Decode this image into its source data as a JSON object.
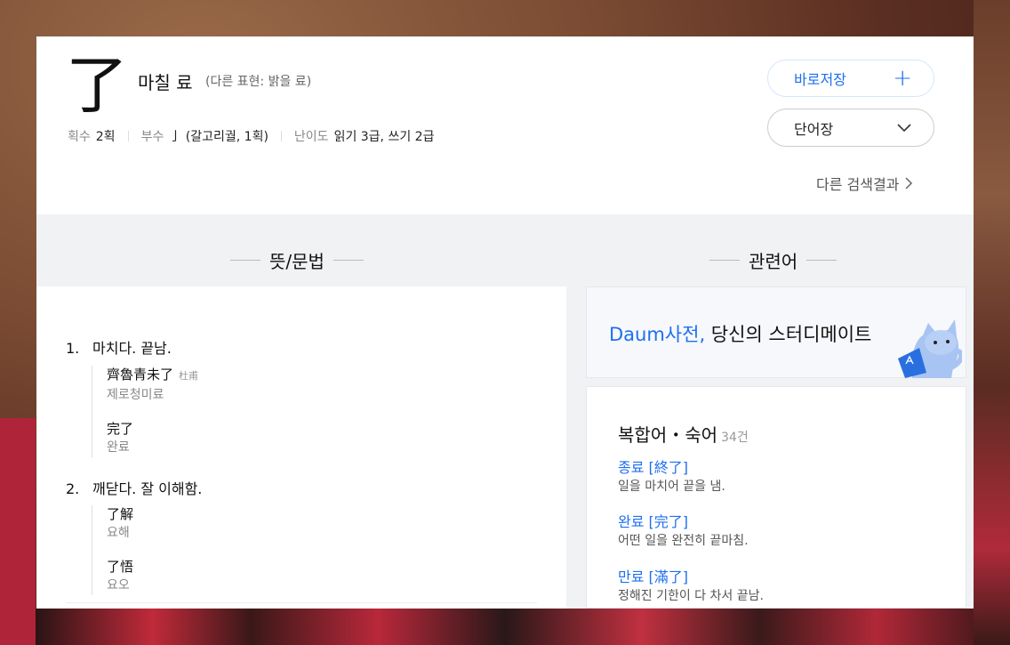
{
  "header": {
    "hanja": "了",
    "reading": "마칠 료",
    "alt_reading": "(다른 표현: 밝을 료)",
    "stroke_label": "획수",
    "stroke_value": "2획",
    "radical_label": "부수",
    "radical_value": "亅 (갈고리궐, 1획)",
    "level_label": "난이도",
    "level_value": "읽기 3급, 쓰기 2급",
    "save_label": "바로저장",
    "wordbook_label": "단어장",
    "other_results": "다른 검색결과"
  },
  "sections": {
    "meaning_title": "뜻/문법",
    "related_title": "관련어"
  },
  "definitions": [
    {
      "num": "1.",
      "text": "마치다. 끝남.",
      "examples": [
        {
          "han": "齊魯青未了",
          "src": "杜甫",
          "kor": "제로청미료"
        },
        {
          "han": "完了",
          "src": "",
          "kor": "완료"
        }
      ]
    },
    {
      "num": "2.",
      "text": "깨닫다. 잘 이해함.",
      "examples": [
        {
          "han": "了解",
          "src": "",
          "kor": "요해"
        },
        {
          "han": "了悟",
          "src": "",
          "kor": "요오"
        }
      ]
    }
  ],
  "banner": {
    "brand": "Daum사전,",
    "text": " 당신의 스터디메이트"
  },
  "related": {
    "title": "복합어・숙어",
    "count": "34건",
    "items": [
      {
        "word": "종료 [終了]",
        "meaning": "일을 마치어 끝을 냄."
      },
      {
        "word": "완료 [完了]",
        "meaning": "어떤 일을 완전히 끝마침."
      },
      {
        "word": "만료 [滿了]",
        "meaning": "정해진 기한이 다 차서 끝남."
      }
    ]
  },
  "colors": {
    "accent": "#1e6ff0",
    "page_bg": "#f0f2f4"
  }
}
